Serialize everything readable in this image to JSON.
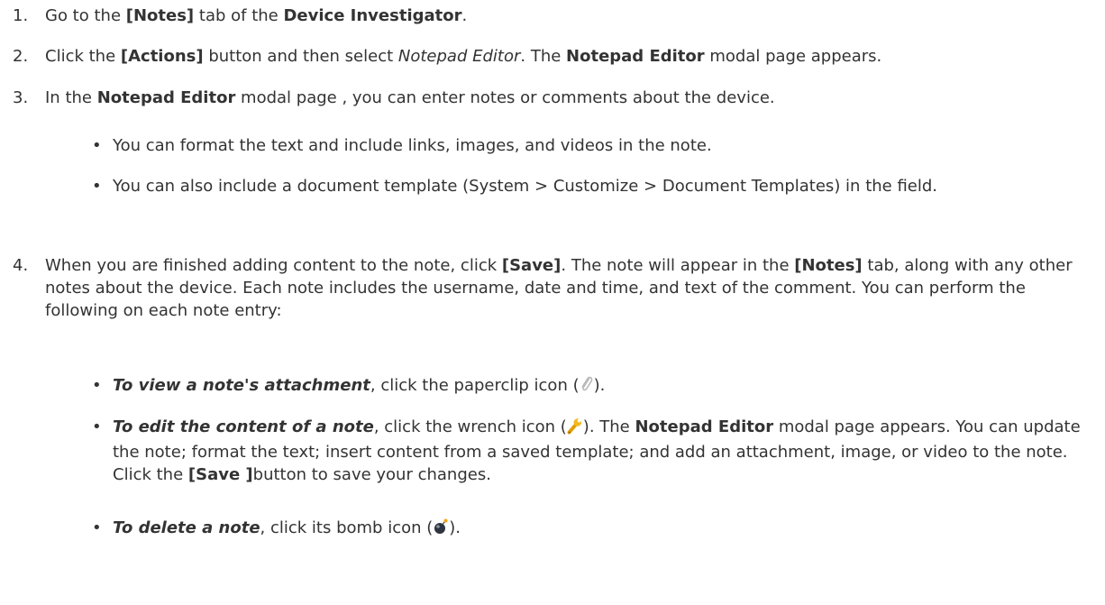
{
  "steps": [
    {
      "num": "1.",
      "parts": [
        "Go to the ",
        "[Notes]",
        " tab of the ",
        "Device Investigator",
        "."
      ]
    },
    {
      "num": "2.",
      "parts": [
        "Click the ",
        "[Actions]",
        " button and then select ",
        "Notepad Editor",
        ". The ",
        "Notepad Editor",
        " modal page appears."
      ]
    },
    {
      "num": "3.",
      "parts": [
        "In the ",
        "Notepad Editor",
        " modal page , you can enter notes or comments about the device."
      ]
    },
    {
      "num": "4.",
      "parts": [
        "When you are finished adding content to the note, click ",
        "[Save]",
        ". The note will appear in the ",
        "[Notes]",
        " tab, along with any other notes about the device. Each note includes the username, date and time, and text of the comment. You can perform the following on each note entry:"
      ]
    }
  ],
  "step3_bullets": [
    "You can format the text and include links, images, and videos in the note.",
    "You can also include a document template (System > Customize > Document Templates) in the field."
  ],
  "step4_bullets": {
    "attachment": [
      "To view a note's attachment",
      ", click the paperclip icon (",
      ")."
    ],
    "edit": [
      "To edit the content of a note",
      ", click the wrench icon (",
      "). The ",
      "Notepad Editor",
      " modal page appears. You can update the note; format the text; insert content from a saved template; and add an attachment, image, or video to the note. Click the ",
      "[Save ]",
      "button to save your changes."
    ],
    "delete": [
      "To delete a note",
      ", click its bomb icon (",
      ")."
    ]
  },
  "bullet_char": "•",
  "icons": {
    "attachment": "paperclip-icon",
    "edit": "wrench-icon",
    "delete": "bomb-icon"
  }
}
